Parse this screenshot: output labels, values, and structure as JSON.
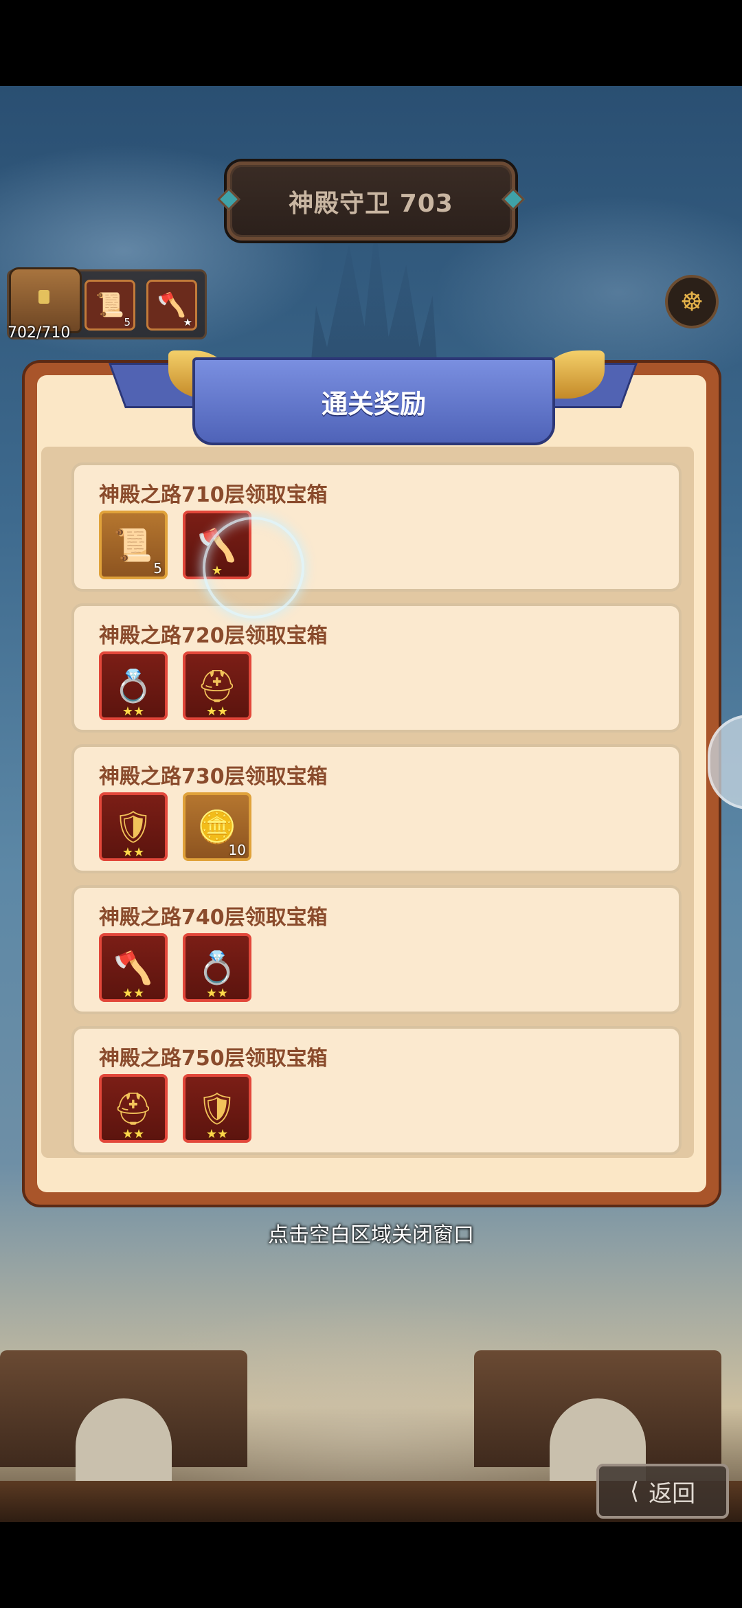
{
  "header": {
    "title": "神殿守卫 703"
  },
  "chest": {
    "progress": "702/710",
    "progress_value": 702,
    "progress_max": 710,
    "preview_items": [
      {
        "icon": "scroll-icon",
        "qty": "5"
      },
      {
        "icon": "axe-icon",
        "stars": "★"
      }
    ]
  },
  "panel": {
    "title": "通关奖励",
    "rewards": [
      {
        "label": "神殿之路710层领取宝箱",
        "items": [
          {
            "icon": "scroll-icon",
            "glyph": "📜",
            "qty": "5"
          },
          {
            "icon": "axe-icon",
            "glyph": "🪓",
            "stars": "★"
          }
        ]
      },
      {
        "label": "神殿之路720层领取宝箱",
        "items": [
          {
            "icon": "ring-icon",
            "glyph": "💍",
            "stars": "★★"
          },
          {
            "icon": "helmet-icon",
            "glyph": "⛑",
            "stars": "★★"
          }
        ]
      },
      {
        "label": "神殿之路730层领取宝箱",
        "items": [
          {
            "icon": "armor-icon",
            "glyph": "🛡",
            "stars": "★★"
          },
          {
            "icon": "gold-coin-icon",
            "glyph": "🪙",
            "qty": "10"
          }
        ]
      },
      {
        "label": "神殿之路740层领取宝箱",
        "items": [
          {
            "icon": "axe-icon",
            "glyph": "🪓",
            "stars": "★★"
          },
          {
            "icon": "ring-icon",
            "glyph": "💍",
            "stars": "★★"
          }
        ]
      },
      {
        "label": "神殿之路750层领取宝箱",
        "items": [
          {
            "icon": "helmet-icon",
            "glyph": "⛑",
            "stars": "★★"
          },
          {
            "icon": "armor-icon",
            "glyph": "🛡",
            "stars": "★★"
          }
        ]
      }
    ]
  },
  "close_hint": "点击空白区域关闭窗口",
  "back_button": {
    "label": "返回",
    "icon": "back-arrow-icon"
  },
  "colors": {
    "panel_border": "#a9552a",
    "panel_bg": "#fbe7c6",
    "ribbon": "#5f73c8",
    "item_border": "#e2473a",
    "title_text": "#8a4b2c"
  }
}
